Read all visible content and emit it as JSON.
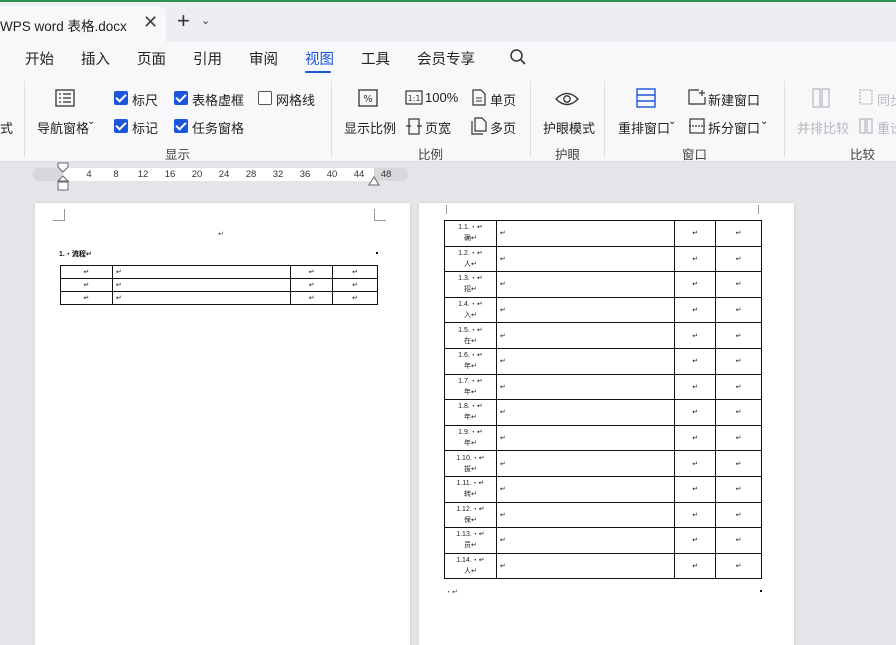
{
  "titlebar": {
    "tab_title": "WPS word 表格.docx",
    "close_symbol": "✕",
    "new_tab_symbol": "+",
    "new_tab_arrow": "⌄"
  },
  "menu": {
    "items": [
      "开始",
      "插入",
      "页面",
      "引用",
      "审阅",
      "视图",
      "工具",
      "会员专享"
    ],
    "active": "视图"
  },
  "ribbon": {
    "partial_left": "式",
    "display": {
      "nav_pane": "导航窗格",
      "ruler": "标尺",
      "table_gridlines": "表格虚框",
      "gridlines": "网格线",
      "marks": "标记",
      "task_pane": "任务窗格",
      "label": "显示"
    },
    "zoom": {
      "zoom_ratio": "显示比例",
      "hundred": "100%",
      "single_page": "单页",
      "page_width": "页宽",
      "multi_page": "多页",
      "label": "比例"
    },
    "eye": {
      "eye_mode": "护眼模式",
      "label": "护眼"
    },
    "window": {
      "new_window": "新建窗口",
      "arrange": "重排窗口",
      "split": "拆分窗口",
      "label": "窗口"
    },
    "compare": {
      "side_by_side": "并排比较",
      "sync": "同步",
      "reset": "重设",
      "label": "比较"
    },
    "dropdown_arrow": "⌄"
  },
  "ruler": {
    "ticks": [
      "4",
      "8",
      "12",
      "16",
      "20",
      "24",
      "28",
      "32",
      "36",
      "40",
      "44",
      "48"
    ]
  },
  "page1": {
    "center_mark": "↵",
    "heading": "1.・流程↵",
    "rows": [
      [
        "↵",
        "↵",
        "↵",
        "↵"
      ],
      [
        "↵",
        "↵",
        "↵",
        "↵"
      ],
      [
        "↵",
        "↵",
        "↵",
        "↵"
      ]
    ]
  },
  "page2": {
    "rows": [
      {
        "num": "1.1.・↵",
        "text": "确↵"
      },
      {
        "num": "1.2.・↵",
        "text": "人↵"
      },
      {
        "num": "1.3.・↵",
        "text": "招↵"
      },
      {
        "num": "1.4.・↵",
        "text": "入↵"
      },
      {
        "num": "1.5.・↵",
        "text": "在↵"
      },
      {
        "num": "1.6.・↵",
        "text": "年↵"
      },
      {
        "num": "1.7.・↵",
        "text": "年↵"
      },
      {
        "num": "1.8.・↵",
        "text": "年↵"
      },
      {
        "num": "1.9.・↵",
        "text": "年↵"
      },
      {
        "num": "1.10.・↵",
        "text": "拔↵"
      },
      {
        "num": "1.11.・↵",
        "text": "转↵"
      },
      {
        "num": "1.12.・↵",
        "text": "保↵"
      },
      {
        "num": "1.13.・↵",
        "text": "员↵"
      },
      {
        "num": "1.14.・↵",
        "text": "人↵"
      }
    ],
    "cell_mark": "↵",
    "end_mark": "・↵"
  }
}
